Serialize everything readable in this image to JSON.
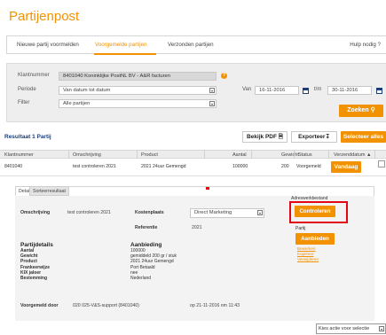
{
  "page": {
    "title": "Partijenpost"
  },
  "tabs": {
    "items": [
      "Nieuwe partij voormelden",
      "Voorgemelde partijen",
      "Verzonden partijen"
    ],
    "help": "Hulp nodig ?"
  },
  "filters": {
    "klantnummer_label": "Klantnummer",
    "klantnummer_value": "8401040 Koninklijke PostNL BV - A&R facturen",
    "periode_label": "Periode",
    "periode_value": "Van datum tot datum",
    "filter_label": "Filter",
    "filter_value": "Alle partijen",
    "van_label": "Van",
    "van_value": "16-11-2016",
    "tm_label": "t/m",
    "tm_value": "30-11-2016",
    "search_button": "Zoeken"
  },
  "results": {
    "title": "Resultaat 1 Partij",
    "pdf_button": "Bekijk PDF",
    "export_button": "Exporteer",
    "select_all_button": "Selecteer alles"
  },
  "table": {
    "headers": [
      "Klantnummer",
      "Omschrijving",
      "Product",
      "Aantal",
      "Gewicht",
      "Status",
      "Verzenddatum"
    ],
    "row": {
      "klantnummer": "8401040",
      "omschrijving": "test controleren 2021",
      "product": "2021 24uur Gemengd",
      "aantal": "100000",
      "gewicht": "200",
      "status": "Voorgemeld",
      "verzend_button": "Vandaag"
    }
  },
  "detail": {
    "tabs": [
      "Details",
      "Sorteerresultaat"
    ],
    "omschrijving_label": "Omschrijving",
    "omschrijving_value": "test controleren 2021",
    "kostenplaats_label": "Kostenplaats",
    "kostenplaats_value": "Direct Marketing",
    "referentie_label": "Referentie",
    "referentie_value": "2021",
    "partijdetails_title": "Partijdetails",
    "partijdetails_labels": [
      "Aantal",
      "Gewicht",
      "Product",
      "Frankeerwijze",
      "KIX jaloer",
      "Bestemming"
    ],
    "aanbieding_title": "Aanbieding",
    "aanbieding_values": [
      "100000",
      "gemiddeld 200 gr / stuk",
      "2021 24uur Gemengd",
      "Port Betaald",
      "nee",
      "Nederland"
    ],
    "voorgemeld_label": "Voorgemeld door",
    "voorgemeld_value": "020 025-V&S-support (8401040)",
    "voorgemeld_date": "op 21-11-2016 om 11:43",
    "side": {
      "adreswerkbestand_label": "Adreswerkbestand",
      "controleren_button": "Controleren",
      "partij_label": "Partij",
      "aanbieden_button": "Aanbieden",
      "links": [
        "Bewerken",
        "Kopiëren",
        "Verwijderen"
      ]
    }
  },
  "footer": {
    "action_select": "Kies actie voor selectie"
  },
  "colors": {
    "brand_orange": "#f39200",
    "navy": "#1c3f7a",
    "highlight_red": "#e30613"
  }
}
